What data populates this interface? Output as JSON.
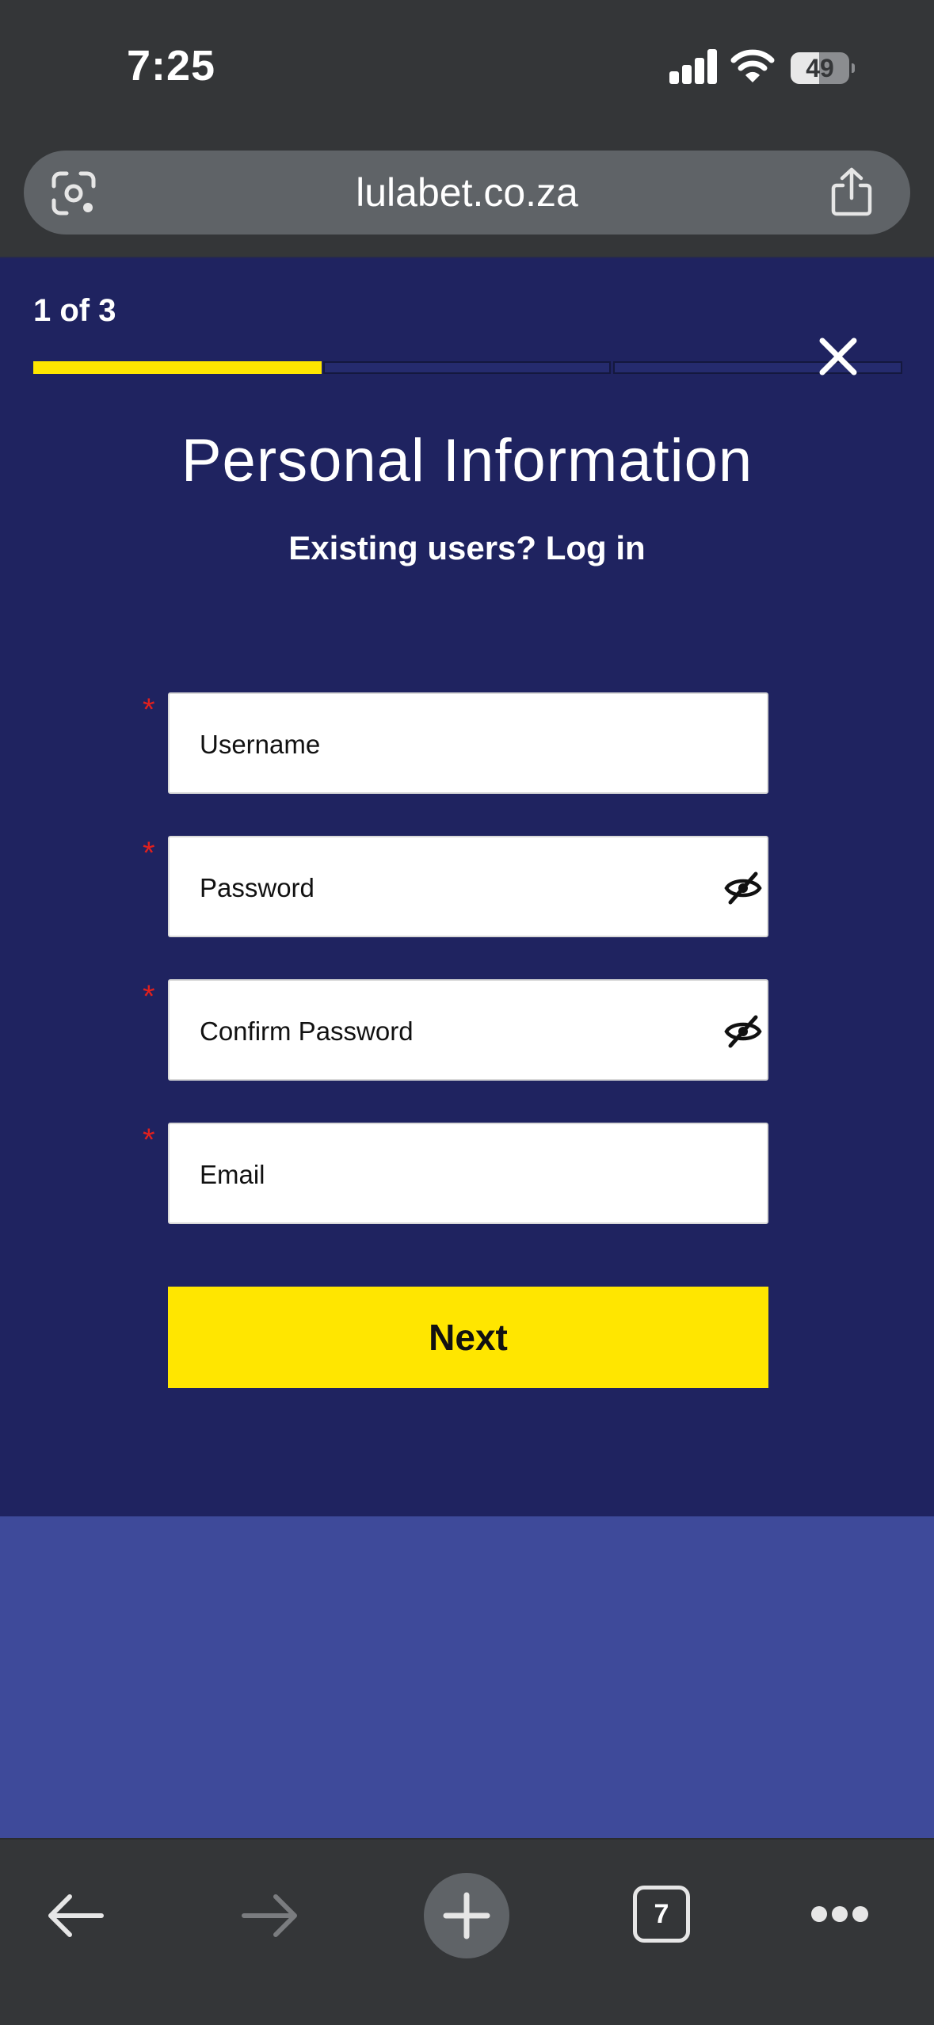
{
  "status_bar": {
    "time": "7:25",
    "battery": "49",
    "battery_level": 0.49
  },
  "browser": {
    "url": "lulabet.co.za",
    "icons": [
      "google-lens-icon",
      "share-icon"
    ],
    "tab_count": "7"
  },
  "signup": {
    "step_label": "1 of 3",
    "progress": {
      "current_step": 1,
      "total_steps": 3
    },
    "title": "Personal Information",
    "login_link": "Existing users? Log in",
    "required_marker": "*",
    "fields": [
      {
        "placeholder": "Username",
        "required": true,
        "icon": null
      },
      {
        "placeholder": "Password",
        "required": true,
        "icon": "eye-slash-icon"
      },
      {
        "placeholder": "Confirm Password",
        "required": true,
        "icon": "eye-slash-icon"
      },
      {
        "placeholder": "Email",
        "required": true,
        "icon": null
      }
    ],
    "next_label": "Next"
  },
  "toolbar": {
    "icons": [
      "back-arrow-icon",
      "forward-arrow-icon",
      "plus-icon",
      "tab-count-icon",
      "more-icon"
    ]
  },
  "colors": {
    "page_bg": "#1f2360",
    "lower_bg": "#3e4a9a",
    "accent": "#ffe600",
    "required": "#e0201d",
    "chrome": "#343638"
  }
}
